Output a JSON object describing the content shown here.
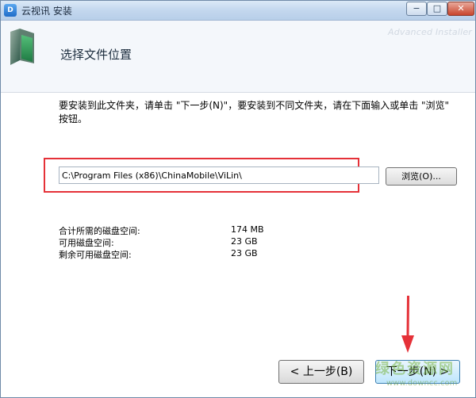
{
  "window": {
    "title": "云视讯 安装",
    "app_icon_text": "D",
    "controls": {
      "minimize": "−",
      "maximize": "□",
      "close": "✕"
    }
  },
  "header": {
    "title": "选择文件位置",
    "brand": "Advanced Installer"
  },
  "body": {
    "instruction": "要安装到此文件夹，请单击 \"下一步(N)\"，要安装到不同文件夹，请在下面输入或单击 \"浏览\" 按钮。",
    "path_value": "C:\\Program Files (x86)\\ChinaMobile\\ViLin\\",
    "browse_label": "浏览(O)...",
    "space": [
      {
        "label": "合计所需的磁盘空间:",
        "value": "174 MB"
      },
      {
        "label": "可用磁盘空间:",
        "value": "23 GB"
      },
      {
        "label": "剩余可用磁盘空间:",
        "value": "23 GB"
      }
    ]
  },
  "footer": {
    "back_label": "< 上一步(B)",
    "next_label": "下一步(N) >"
  },
  "watermark": {
    "logo": "绿色资源网",
    "url": "www.downcc.com"
  },
  "colors": {
    "highlight": "#e53138",
    "arrow": "#e53138"
  }
}
